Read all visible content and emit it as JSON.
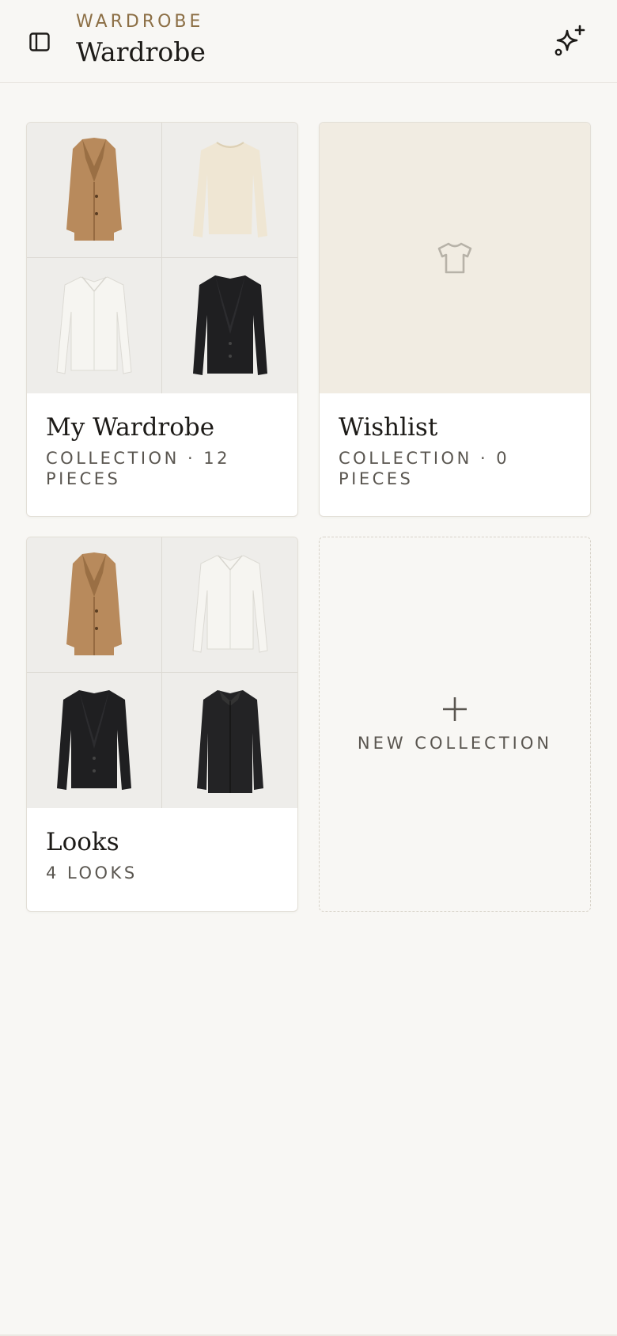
{
  "header": {
    "eyebrow": "WARDROBE",
    "title": "Wardrobe"
  },
  "collections": [
    {
      "title": "My Wardrobe",
      "meta": "COLLECTION · 12 PIECES",
      "thumbnails": [
        "camel-coat",
        "cream-sweater",
        "white-blouse",
        "black-blazer"
      ]
    },
    {
      "title": "Wishlist",
      "meta": "COLLECTION · 0 PIECES",
      "thumbnails": [],
      "placeholder_icon": "tshirt-icon"
    },
    {
      "title": "Looks",
      "meta": "4 LOOKS",
      "thumbnails": [
        "camel-coat",
        "white-blouse",
        "black-blazer",
        "black-overcoat"
      ]
    }
  ],
  "new_collection": {
    "label": "NEW COLLECTION"
  },
  "colors": {
    "background": "#f8f7f4",
    "accent": "#8c6f45",
    "camel": "#b88a5c",
    "cream": "#efe6d3",
    "black_garment": "#1f1f21",
    "wishlist_cover": "#f1ece2"
  }
}
